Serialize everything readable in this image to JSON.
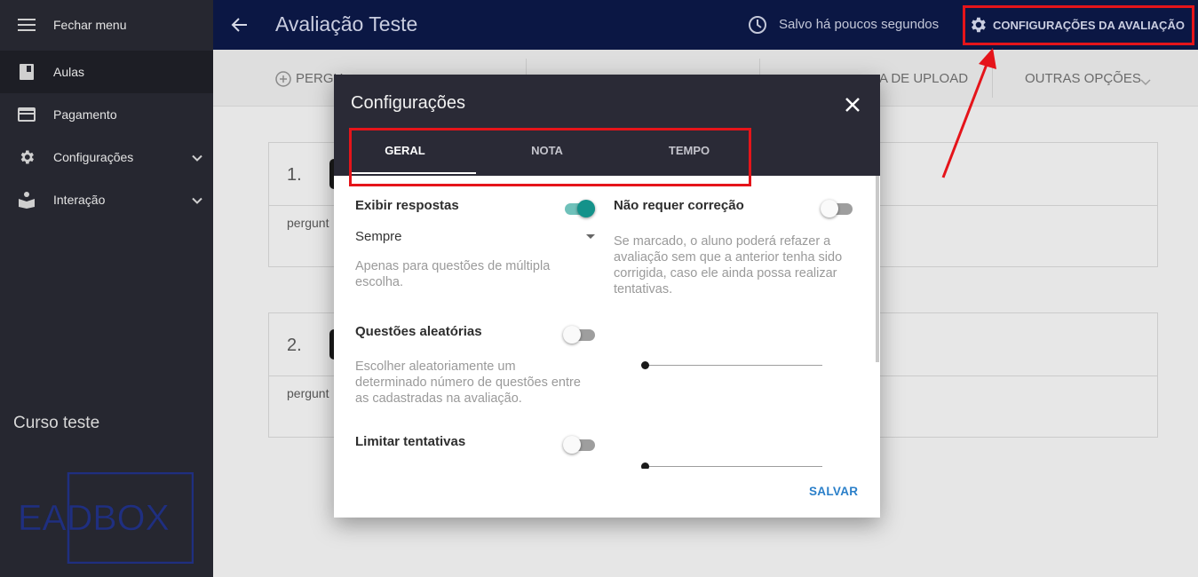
{
  "sidebar": {
    "items": [
      {
        "label": "Fechar menu",
        "icon": "menu-icon"
      },
      {
        "label": "Aulas",
        "icon": "book-icon"
      },
      {
        "label": "Pagamento",
        "icon": "credit-card-icon"
      },
      {
        "label": "Configurações",
        "icon": "gear-icon"
      },
      {
        "label": "Interação",
        "icon": "reader-icon"
      }
    ],
    "course_name": "Curso teste",
    "logo_text": "EADBOX"
  },
  "header": {
    "title": "Avaliação Teste",
    "saved_status": "Salvo há poucos segundos",
    "settings_button": "CONFIGURAÇÕES DA AVALIAÇÃO"
  },
  "toolbar": {
    "items": [
      "PERGU",
      "A DE UPLOAD",
      "OUTRAS OPÇÕES"
    ]
  },
  "questions": [
    {
      "number": "1.",
      "text": "pergunt"
    },
    {
      "number": "2.",
      "text": "pergunt"
    }
  ],
  "modal": {
    "title": "Configurações",
    "tabs": [
      "GERAL",
      "NOTA",
      "TEMPO"
    ],
    "active_tab": "GERAL",
    "settings": {
      "exibir_respostas": {
        "label": "Exibir respostas",
        "enabled": true,
        "select_value": "Sempre",
        "help": "Apenas para questões de múltipla escolha."
      },
      "nao_requer_correcao": {
        "label": "Não requer correção",
        "enabled": false,
        "help": "Se marcado, o aluno poderá refazer a avaliação sem que a anterior tenha sido corrigida, caso ele ainda possa realizar tentativas."
      },
      "questoes_aleatorias": {
        "label": "Questões aleatórias",
        "enabled": false,
        "help": "Escolher aleatoriamente um determinado número de questões entre as cadastradas na avaliação.",
        "slider_value": 0
      },
      "limitar_tentativas": {
        "label": "Limitar tentativas",
        "enabled": false,
        "slider_value": 0
      }
    },
    "save_label": "SALVAR"
  },
  "colors": {
    "sidebar_bg": "#262730",
    "header_bg": "#0b1744",
    "modal_header_bg": "#2a2a36",
    "toggle_on": "#14928a",
    "save_button": "#2a7fc9",
    "annotation_red": "#e5141a"
  }
}
